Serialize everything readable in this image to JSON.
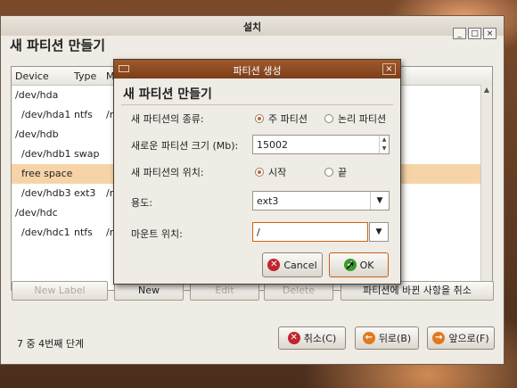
{
  "window": {
    "title": "설치",
    "heading": "새 파티션 만들기",
    "controls": [
      "_",
      "□",
      "×"
    ]
  },
  "table": {
    "columns": [
      "Device",
      "Type",
      "M"
    ],
    "rows": [
      {
        "device": "/dev/hda",
        "type": "",
        "m": "",
        "selected": false
      },
      {
        "device": "/dev/hda1",
        "type": "ntfs",
        "m": "/r",
        "selected": false
      },
      {
        "device": "/dev/hdb",
        "type": "",
        "m": "",
        "selected": false
      },
      {
        "device": "/dev/hdb1",
        "type": "swap",
        "m": "",
        "selected": false
      },
      {
        "device": "free space",
        "type": "",
        "m": "",
        "selected": true
      },
      {
        "device": "/dev/hdb3",
        "type": "ext3",
        "m": "/r",
        "selected": false
      },
      {
        "device": "/dev/hdc",
        "type": "",
        "m": "",
        "selected": false
      },
      {
        "device": "/dev/hdc1",
        "type": "ntfs",
        "m": "/r",
        "selected": false
      }
    ]
  },
  "buttons": {
    "new_label": "New Label",
    "new": "New",
    "edit": "Edit",
    "delete": "Delete",
    "undo": "파티션에 바뀐 사항을 취소"
  },
  "status": "7 중 4번째 단계",
  "nav": {
    "cancel": "취소(C)",
    "back": "뒤로(B)",
    "forward": "앞으로(F)"
  },
  "dialog": {
    "title": "파티션 생성",
    "heading": "새 파티션 만들기",
    "type_label": "새 파티션의 종류:",
    "type_primary": "주 파티션",
    "type_logical": "논리 파티션",
    "type_selected": "주 파티션",
    "size_label": "새로운 파티션 크기 (Mb):",
    "size_value": "15002",
    "position_label": "새 파티션의 위치:",
    "position_start": "시작",
    "position_end": "끝",
    "position_selected": "시작",
    "use_label": "용도:",
    "use_value": "ext3",
    "mount_label": "마운트 위치:",
    "mount_value": "/",
    "cancel": "Cancel",
    "ok": "OK"
  },
  "colors": {
    "accent": "#d4620f",
    "dialog_titlebar": "#8b4a22",
    "selection": "#f7d4a8",
    "cancel_icon": "#c0262d",
    "arrow_icon": "#e07a1e",
    "ok_icon": "#3a9a2a"
  }
}
